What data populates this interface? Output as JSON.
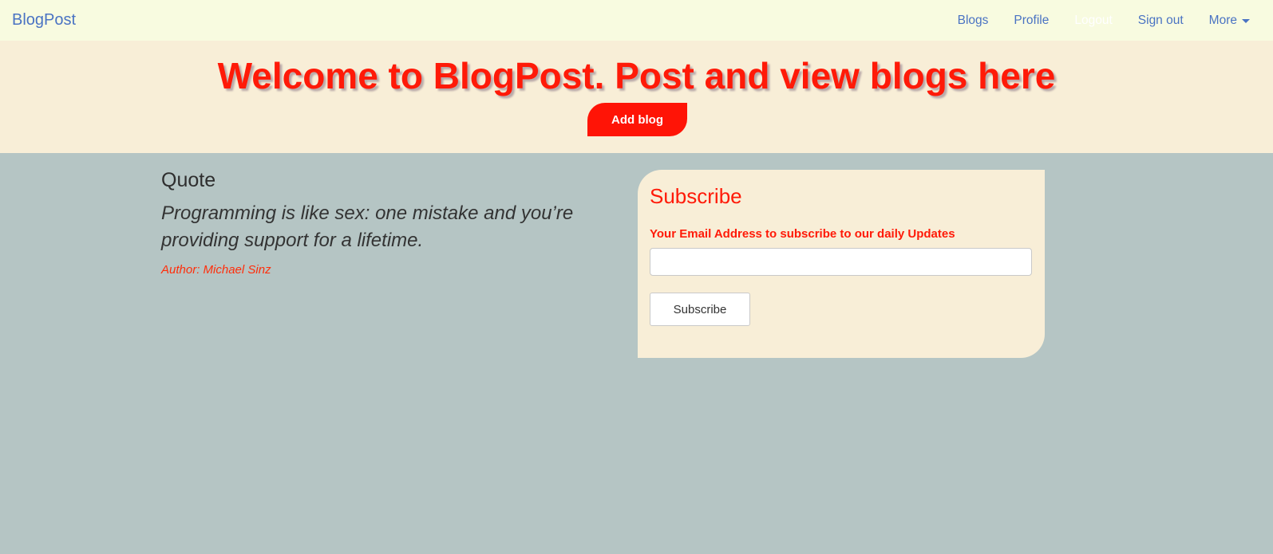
{
  "navbar": {
    "brand": "BlogPost",
    "links": [
      {
        "label": "Blogs"
      },
      {
        "label": "Profile"
      },
      {
        "label": "Logout"
      },
      {
        "label": "Sign out"
      }
    ],
    "more_label": "More",
    "colors": {
      "background": "#f8fbe0",
      "link": "#4a73c3"
    }
  },
  "hero": {
    "title": "Welcome to BlogPost. Post and view blogs here",
    "add_blog_label": "Add blog",
    "colors": {
      "background": "#f8eed7",
      "accent": "#ff1a08"
    }
  },
  "quote": {
    "heading": "Quote",
    "text": "Programming is like sex: one mistake and you’re providing support for a lifetime.",
    "author": "Author: Michael Sinz"
  },
  "subscribe": {
    "title": "Subscribe",
    "label": "Your Email Address to subscribe to our daily Updates",
    "input_value": "",
    "input_placeholder": "",
    "button_label": "Subscribe"
  },
  "page": {
    "colors": {
      "background": "#b5c5c4"
    }
  }
}
